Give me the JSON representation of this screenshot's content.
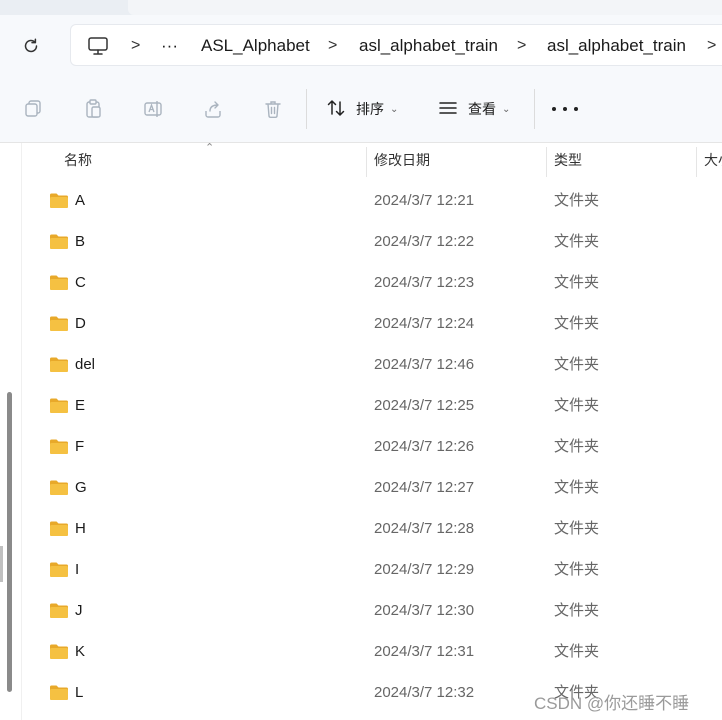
{
  "address": {
    "more_label": "···",
    "crumbs": [
      "ASL_Alphabet",
      "asl_alphabet_train",
      "asl_alphabet_train"
    ],
    "separator": ">"
  },
  "toolbar": {
    "sort_label": "排序",
    "view_label": "查看"
  },
  "columns": {
    "name": "名称",
    "date": "修改日期",
    "type": "类型",
    "size": "大小"
  },
  "files": [
    {
      "name": "A",
      "date": "2024/3/7 12:21",
      "type": "文件夹"
    },
    {
      "name": "B",
      "date": "2024/3/7 12:22",
      "type": "文件夹"
    },
    {
      "name": "C",
      "date": "2024/3/7 12:23",
      "type": "文件夹"
    },
    {
      "name": "D",
      "date": "2024/3/7 12:24",
      "type": "文件夹"
    },
    {
      "name": "del",
      "date": "2024/3/7 12:46",
      "type": "文件夹"
    },
    {
      "name": "E",
      "date": "2024/3/7 12:25",
      "type": "文件夹"
    },
    {
      "name": "F",
      "date": "2024/3/7 12:26",
      "type": "文件夹"
    },
    {
      "name": "G",
      "date": "2024/3/7 12:27",
      "type": "文件夹"
    },
    {
      "name": "H",
      "date": "2024/3/7 12:28",
      "type": "文件夹"
    },
    {
      "name": "I",
      "date": "2024/3/7 12:29",
      "type": "文件夹"
    },
    {
      "name": "J",
      "date": "2024/3/7 12:30",
      "type": "文件夹"
    },
    {
      "name": "K",
      "date": "2024/3/7 12:31",
      "type": "文件夹"
    },
    {
      "name": "L",
      "date": "2024/3/7 12:32",
      "type": "文件夹"
    }
  ],
  "watermark": "CSDN @你还睡不睡",
  "colors": {
    "folder": "#f5c142",
    "folder_back": "#e8a92a",
    "toolbar_bg": "#f7f9fc",
    "scrollbar": "#8a8a8a"
  }
}
